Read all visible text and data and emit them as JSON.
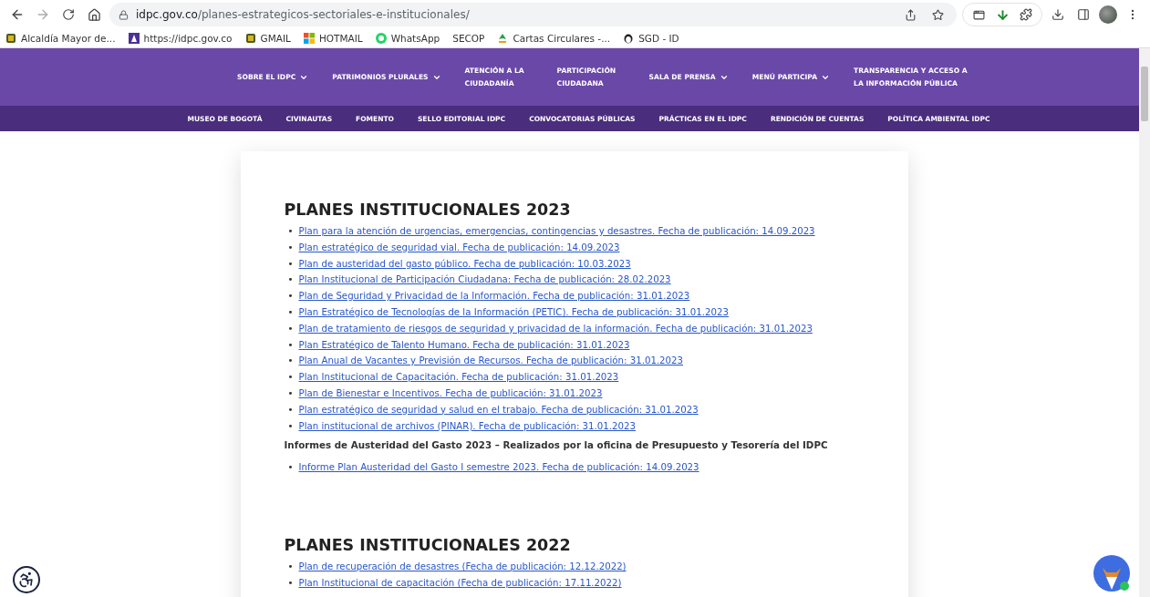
{
  "browser": {
    "url_host": "idpc.gov.co",
    "url_path": "/planes-estrategicos-sectoriales-e-institucionales/"
  },
  "bookmarks": [
    {
      "label": "Alcaldía Mayor de...",
      "kind": "crest"
    },
    {
      "label": "https://idpc.gov.co",
      "kind": "idpc"
    },
    {
      "label": "GMAIL",
      "kind": "crest"
    },
    {
      "label": "HOTMAIL",
      "kind": "windows"
    },
    {
      "label": "WhatsApp",
      "kind": "whatsapp"
    },
    {
      "label": "SECOP",
      "kind": "none"
    },
    {
      "label": "Cartas Circulares -...",
      "kind": "leaf"
    },
    {
      "label": "SGD - ID",
      "kind": "penguin"
    }
  ],
  "main_nav": [
    {
      "label": "SOBRE EL IDPC",
      "dropdown": true
    },
    {
      "label": "PATRIMONIOS PLURALES",
      "dropdown": true
    },
    {
      "label": "ATENCIÓN A LA CIUDADANÍA",
      "dropdown": false
    },
    {
      "label": "PARTICIPACIÓN CIUDADANA",
      "dropdown": false
    },
    {
      "label": "SALA DE PRENSA",
      "dropdown": true
    },
    {
      "label": "MENÚ PARTICIPA",
      "dropdown": true
    },
    {
      "label": "TRANSPARENCIA Y ACCESO A LA INFORMACIÓN PÚBLICA",
      "dropdown": false
    }
  ],
  "sub_nav": [
    "MUSEO DE BOGOTÁ",
    "CIVINAUTAS",
    "FOMENTO",
    "SELLO EDITORIAL IDPC",
    "CONVOCATORIAS PÚBLICAS",
    "PRÁCTICAS EN EL IDPC",
    "RENDICIÓN DE CUENTAS",
    "POLÍTICA AMBIENTAL IDPC"
  ],
  "sections": [
    {
      "title": "PLANES INSTITUCIONALES 2023",
      "marker": "•",
      "links": [
        "Plan para la atención de urgencias, emergencias, contingencias y desastres. Fecha de publicación: 14.09.2023",
        "Plan estratégico de seguridad vial. Fecha de publicación: 14.09.2023",
        "Plan de austeridad del gasto público. Fecha de publicación: 10.03.2023",
        "Plan Institucional de Participación Ciudadana: Fecha de publicación: 28.02.2023",
        "Plan de Seguridad y Privacidad de la Información. Fecha de publicación: 31.01.2023",
        "Plan Estratégico de Tecnologías de la Información (PETIC). Fecha de publicación: 31.01.2023",
        "Plan de tratamiento de riesgos de seguridad y privacidad de la información. Fecha de publicación: 31.01.2023",
        "Plan Estratégico de Talento Humano. Fecha de publicación: 31.01.2023",
        "Plan Anual de Vacantes y Previsión de Recursos. Fecha de publicación: 31.01.2023",
        "Plan Institucional de Capacitación. Fecha de publicación: 31.01.2023",
        "Plan de Bienestar e Incentivos. Fecha de publicación: 31.01.2023",
        "Plan estratégico de seguridad y salud en el trabajo. Fecha de publicación: 31.01.2023",
        "Plan institucional de archivos (PINAR). Fecha de publicación: 31.01.2023"
      ],
      "subheading": "Informes de Austeridad del Gasto 2023 – Realizados por la oficina de Presupuesto y Tesorería del IDPC",
      "sub_links": [
        "Informe Plan Austeridad del Gasto I semestre 2023. Fecha de publicación: 14.09.2023"
      ]
    },
    {
      "title": "PLANES INSTITUCIONALES 2022",
      "marker": "•",
      "links": [
        "Plan de recuperación de desastres (Fecha de publicación: 12.12.2022)",
        "Plan Institucional de capacitación (Fecha de publicación: 17.11.2022)"
      ]
    }
  ]
}
